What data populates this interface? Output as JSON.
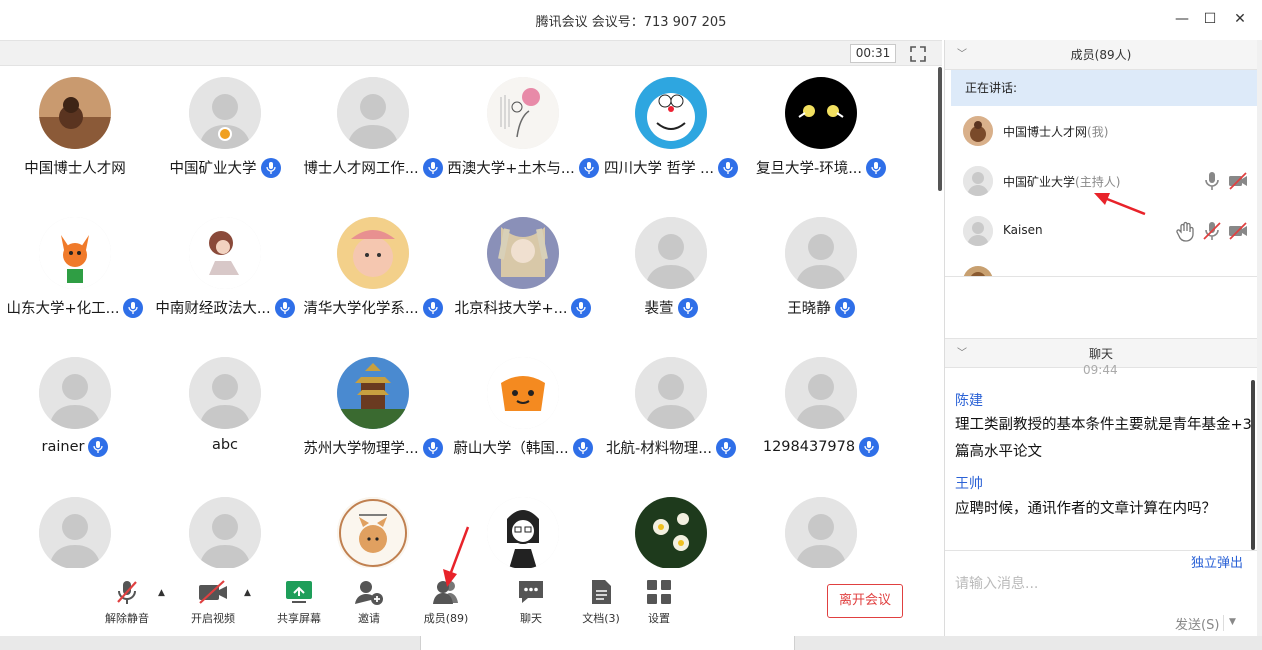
{
  "window": {
    "title": "腾讯会议 会议号：713 907 205",
    "minimize_glyph": "—",
    "maximize_glyph": "☐",
    "close_glyph": "✕"
  },
  "video": {
    "timer": "00:31",
    "participants": [
      {
        "name": "中国博士人才网",
        "mic": false,
        "avatar": "photo-brown"
      },
      {
        "name": "中国矿业大学",
        "mic": true,
        "avatar": "default",
        "host": true
      },
      {
        "name": "博士人才网工作...",
        "mic": true,
        "avatar": "default"
      },
      {
        "name": "西澳大学+土木与...",
        "mic": true,
        "avatar": "sketch-lotus"
      },
      {
        "name": "四川大学 哲学 ...",
        "mic": true,
        "avatar": "doraemon"
      },
      {
        "name": "复旦大学-环境...",
        "mic": true,
        "avatar": "black-birds"
      },
      {
        "name": "山东大学+化工...",
        "mic": true,
        "avatar": "fox"
      },
      {
        "name": "中南财经政法大...",
        "mic": true,
        "avatar": "girl-drawing"
      },
      {
        "name": "清华大学化学系...",
        "mic": true,
        "avatar": "baby"
      },
      {
        "name": "北京科技大学+...",
        "mic": true,
        "avatar": "anime"
      },
      {
        "name": "裴萱",
        "mic": true,
        "avatar": "default"
      },
      {
        "name": "王晓静",
        "mic": true,
        "avatar": "default"
      },
      {
        "name": "rainer",
        "mic": true,
        "avatar": "default"
      },
      {
        "name": "abc",
        "mic": false,
        "avatar": "default"
      },
      {
        "name": "苏州大学物理学...",
        "mic": true,
        "avatar": "tower"
      },
      {
        "name": "蔚山大学（韩国...",
        "mic": true,
        "avatar": "orange-robot"
      },
      {
        "name": "北航-材料物理...",
        "mic": true,
        "avatar": "default"
      },
      {
        "name": "1298437978",
        "mic": true,
        "avatar": "default"
      },
      {
        "name": "",
        "mic": false,
        "avatar": "default"
      },
      {
        "name": "",
        "mic": false,
        "avatar": "default"
      },
      {
        "name": "",
        "mic": false,
        "avatar": "shiba"
      },
      {
        "name": "",
        "mic": false,
        "avatar": "cartoon-man"
      },
      {
        "name": "",
        "mic": false,
        "avatar": "flowers"
      },
      {
        "name": "",
        "mic": false,
        "avatar": "default"
      }
    ]
  },
  "toolbar": {
    "unmute": "解除静音",
    "start_video": "开启视频",
    "share_screen": "共享屏幕",
    "invite": "邀请",
    "members": "成员(89)",
    "chat": "聊天",
    "docs": "文档(3)",
    "settings": "设置",
    "leave": "离开会议",
    "caret": "▲"
  },
  "members_panel": {
    "header": "成员(89人)",
    "speaking_label": "正在讲话:",
    "members": [
      {
        "name": "中国博士人才网",
        "tag": "(我)"
      },
      {
        "name": "中国矿业大学",
        "tag": "(主持人)"
      },
      {
        "name": "Kaisen",
        "tag": ""
      }
    ]
  },
  "chat_panel": {
    "header": "聊天",
    "timestamp": "09:44",
    "messages": [
      {
        "sender": "陈建",
        "text": "理工类副教授的基本条件主要就是青年基金+3篇高水平论文"
      },
      {
        "sender": "王帅",
        "text": "应聘时候，通讯作者的文章计算在内吗？"
      }
    ],
    "popout": "独立弹出",
    "input_placeholder": "请输入消息...",
    "send": "发送(S)",
    "send_caret": "▼",
    "collapse_glyph": "﹀"
  },
  "colors": {
    "accent": "#2f6fe8",
    "leave": "#e04040",
    "arrow": "#e8232a",
    "speaking_bg": "#ddeaf9"
  }
}
